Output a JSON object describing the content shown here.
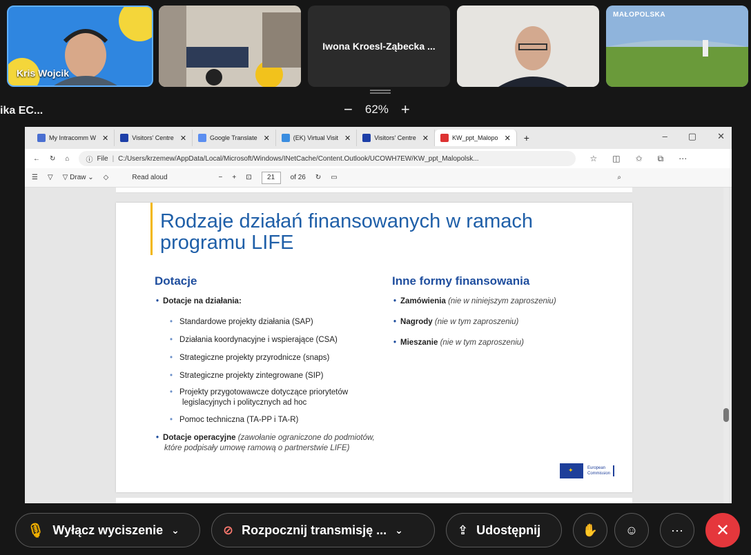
{
  "participants": [
    {
      "name": "Kris Wojcik"
    },
    {
      "name": ""
    },
    {
      "name": "Iwona Kroesl-Ząbecka ..."
    },
    {
      "name": ""
    },
    {
      "badge": "MAŁOPOLSKA"
    }
  ],
  "zoom": {
    "left_label": "ika EC...",
    "minus": "−",
    "value": "62%",
    "plus": "+"
  },
  "browser": {
    "tabs": [
      {
        "label": "My Intracomm W",
        "color": "#4a6fd1"
      },
      {
        "label": "Visitors' Centre",
        "color": "#1d3fa8"
      },
      {
        "label": "Google Translate",
        "color": "#5b8ef0"
      },
      {
        "label": "(EK) Virtual Visit",
        "color": "#3a8de0"
      },
      {
        "label": "Visitors' Centre",
        "color": "#1d3fa8"
      },
      {
        "label": "KW_ppt_Malopo",
        "color": "#d33",
        "active": true
      }
    ],
    "new_tab": "+",
    "window_controls": [
      "–",
      "▢",
      "✕"
    ],
    "address_prefix": "File",
    "address": "C:/Users/krzemew/AppData/Local/Microsoft/Windows/INetCache/Content.Outlook/UCOWH7EW/KW_ppt_Malopolsk...",
    "pdf_toolbar": {
      "draw": "Draw",
      "read_aloud": "Read aloud",
      "page": "21",
      "of_pages": "of 26"
    }
  },
  "slide": {
    "title": "Rodzaje działań finansowanych w ramach programu LIFE",
    "left_heading": "Dotacje",
    "left_main": "Dotacje na działania:",
    "left_sub": [
      "Standardowe projekty działania (SAP)",
      "Działania koordynacyjne i wspierające (CSA)",
      "Strategiczne projekty przyrodnicze (snaps)",
      "Strategiczne projekty zintegrowane (SIP)",
      "Projekty przygotowawcze dotyczące priorytetów legislacyjnych i politycznych ad hoc",
      "Pomoc techniczna (TA-PP i TA-R)"
    ],
    "left_op_bold": "Dotacje operacyjne",
    "left_op_italic": "(zawołanie ograniczone do podmiotów, które podpisały umowę ramową o partnerstwie LIFE)",
    "right_heading": "Inne formy finansowania",
    "right_items": [
      {
        "bold": "Zamówienia",
        "italic": "(nie w niniejszym zaproszeniu)"
      },
      {
        "bold": "Nagrody",
        "italic": "(nie w tym zaproszeniu)"
      },
      {
        "bold": "Mieszanie",
        "italic": "(nie w tym zaproszeniu)"
      }
    ],
    "logo_line1": "European",
    "logo_line2": "Commission"
  },
  "controls": {
    "mute_label": "Wyłącz wyciszenie",
    "video_label": "Rozpocznij transmisję ...",
    "share_label": "Udostępnij",
    "more": "···",
    "end": "✕",
    "end_color": "#e5373c"
  }
}
